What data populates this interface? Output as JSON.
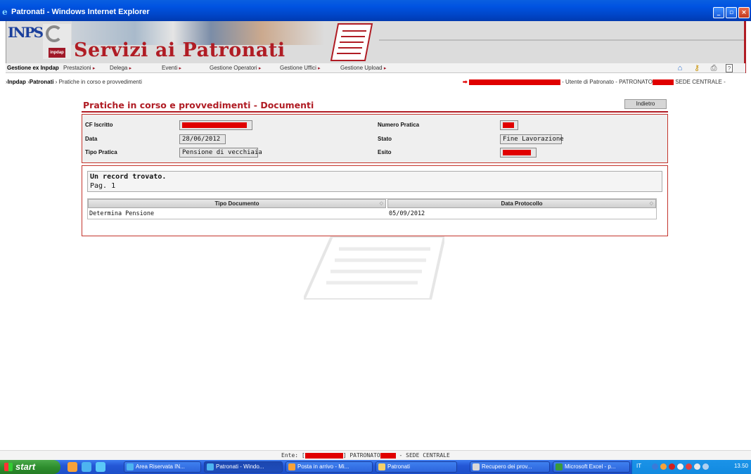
{
  "window": {
    "title": "Patronati - Windows Internet Explorer",
    "controls": [
      "minimize",
      "maximize",
      "close"
    ]
  },
  "header": {
    "logo_inps": "INPS",
    "logo_inpdap": "inpdap",
    "banner_title": "Servizi ai Patronati"
  },
  "menu": {
    "gestione": "Gestione ex Inpdap",
    "items": [
      "Prestazioni",
      "Delega",
      "Eventi",
      "Gestione Operatori",
      "Gestione Uffici",
      "Gestione Upload"
    ],
    "toolbar_icons": [
      "home-icon",
      "key-icon",
      "print-icon",
      "help-icon"
    ],
    "help_label": "?"
  },
  "breadcrumb": {
    "part1": "Inpdap",
    "part2": "Patronati",
    "part3": "Pratiche in corso e provvedimenti"
  },
  "user": {
    "role": "- Utente di Patronato - PATRONATO",
    "sede": "SEDE CENTRALE -"
  },
  "page": {
    "title": "Pratiche in corso e provvedimenti - Documenti",
    "back_button": "Indietro"
  },
  "details": {
    "cf_label": "CF Iscritto",
    "data_label": "Data",
    "data_value": "28/06/2012",
    "tipo_label": "Tipo Pratica",
    "tipo_value": "Pensione di vecchiaia",
    "numero_label": "Numero Pratica",
    "stato_label": "Stato",
    "stato_value": "Fine Lavorazione",
    "esito_label": "Esito"
  },
  "results": {
    "summary": "Un record trovato.",
    "page": "Pag. 1",
    "columns": [
      "Tipo Documento",
      "Data Protocollo"
    ],
    "rows": [
      [
        "Determina Pensione",
        "05/09/2012"
      ]
    ]
  },
  "footer": {
    "ente_prefix": "Ente: [",
    "ente_mid": "] PATRONATO",
    "ente_suffix": " - SEDE CENTRALE"
  },
  "taskbar": {
    "start": "start",
    "tasks": [
      "Area Riservata IN...",
      "Patronati - Windo...",
      "Posta in arrivo - Mi...",
      "Patronati",
      "Recupero dei prov...",
      "Microsoft Excel - p..."
    ],
    "language": "IT",
    "clock": "13.50"
  }
}
